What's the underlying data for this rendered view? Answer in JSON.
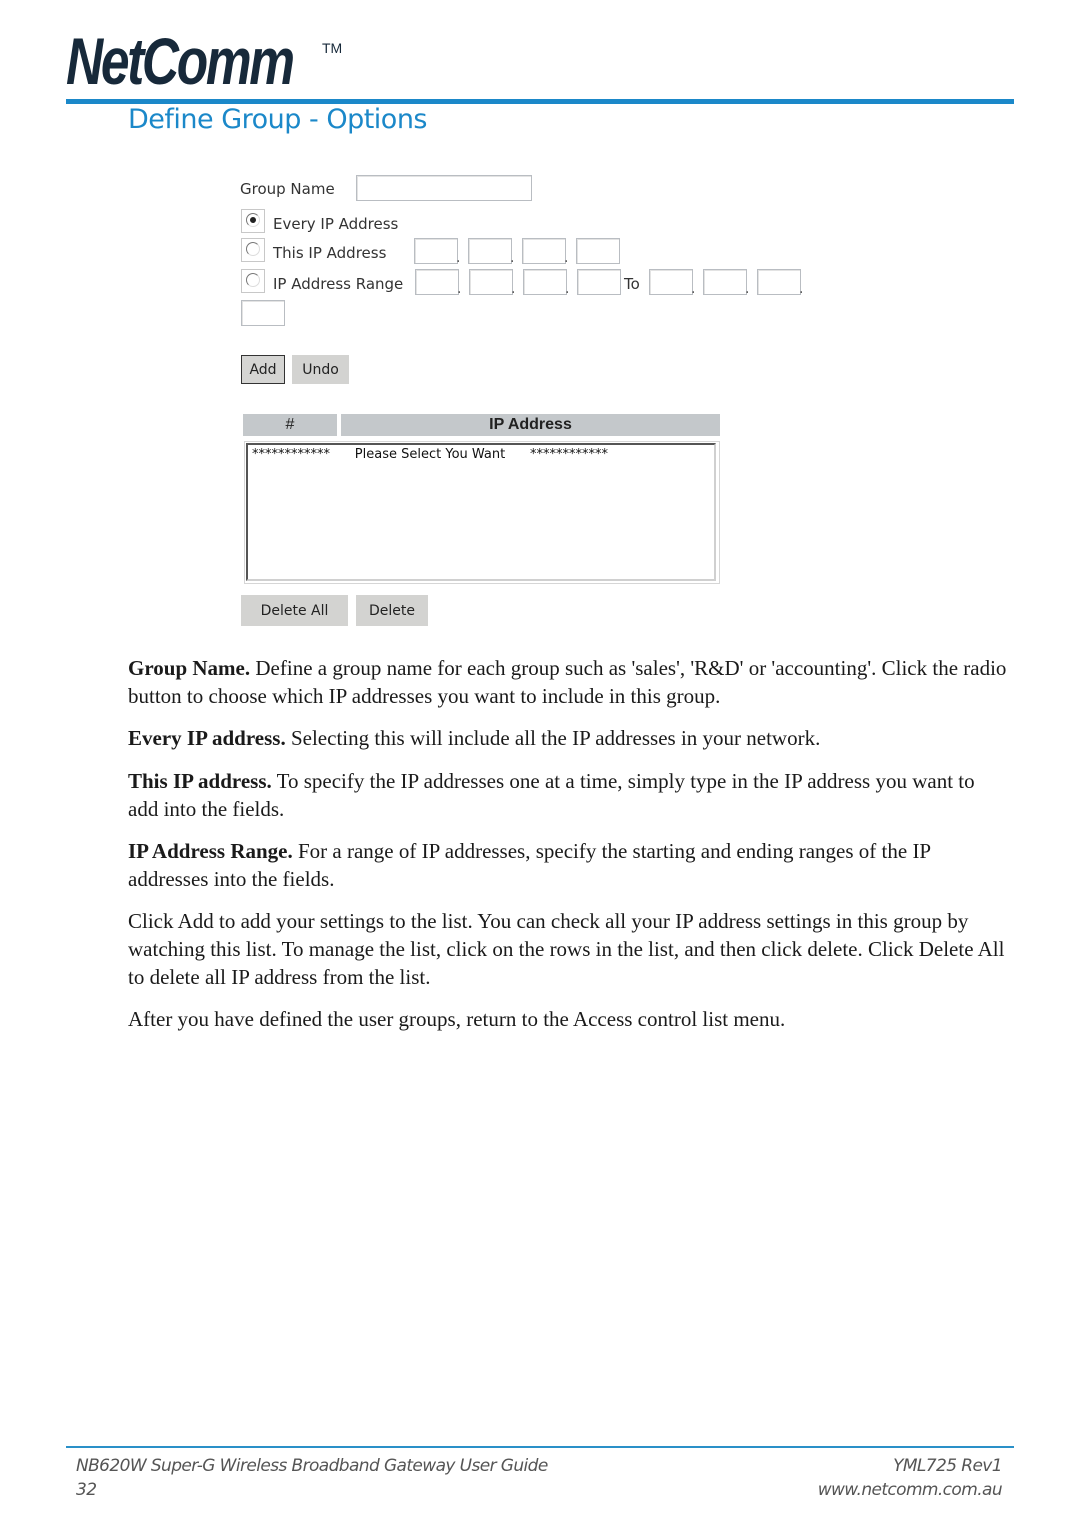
{
  "header": {
    "logo_text": "NetComm",
    "trademark": "TM",
    "page_title": "Define Group - Options"
  },
  "form": {
    "group_name_label": "Group Name",
    "group_name_value": "",
    "options": [
      {
        "label": "Every IP Address",
        "selected": true
      },
      {
        "label": "This IP Address",
        "selected": false
      },
      {
        "label": "IP Address Range",
        "selected": false
      }
    ],
    "separator": ".",
    "to_label": "To",
    "this_ip_octets": [
      "",
      "",
      "",
      ""
    ],
    "range_start_octets": [
      "",
      "",
      "",
      ""
    ],
    "range_end_octets": [
      "",
      "",
      "",
      ""
    ],
    "add_label": "Add",
    "undo_label": "Undo"
  },
  "list": {
    "columns": [
      "#",
      "IP Address"
    ],
    "rows": [
      "************      Please Select You Want      ************"
    ],
    "delete_all_label": "Delete All",
    "delete_label": "Delete"
  },
  "description": [
    {
      "term": "Group Name.",
      "text": " Define a group name for each group such as 'sales', 'R&D' or 'accounting'. Click the radio button to choose which IP addresses you want to include in this group."
    },
    {
      "term": "Every IP address.",
      "text": " Selecting this will include all the IP addresses in your network."
    },
    {
      "term": "This IP address.",
      "text": " To specify the IP addresses one at a time, simply type in the IP address you want to add into the fields."
    },
    {
      "term": "IP Address Range.",
      "text": " For a range of IP addresses, specify the starting and ending ranges of the IP addresses into the fields."
    },
    {
      "term": "",
      "text": "Click Add to add your settings to the list.  You can check all your IP address settings in this group by watching this list. To manage the list, click on the rows in the list, and then click delete. Click Delete All to delete all IP address from the list."
    },
    {
      "term": "",
      "text": "After you have defined the user groups, return to the Access control list menu."
    }
  ],
  "footer": {
    "guide_title": "NB620W Super-G Wireless Broadband  Gateway User Guide",
    "page_number": "32",
    "doc_code": "YML725 Rev1",
    "website": "www.netcomm.com.au"
  },
  "colors": {
    "accent": "#1b88c9",
    "logo": "#17293a",
    "button_bg": "#d3d3d1",
    "table_header_bg": "#c4c8cb"
  }
}
